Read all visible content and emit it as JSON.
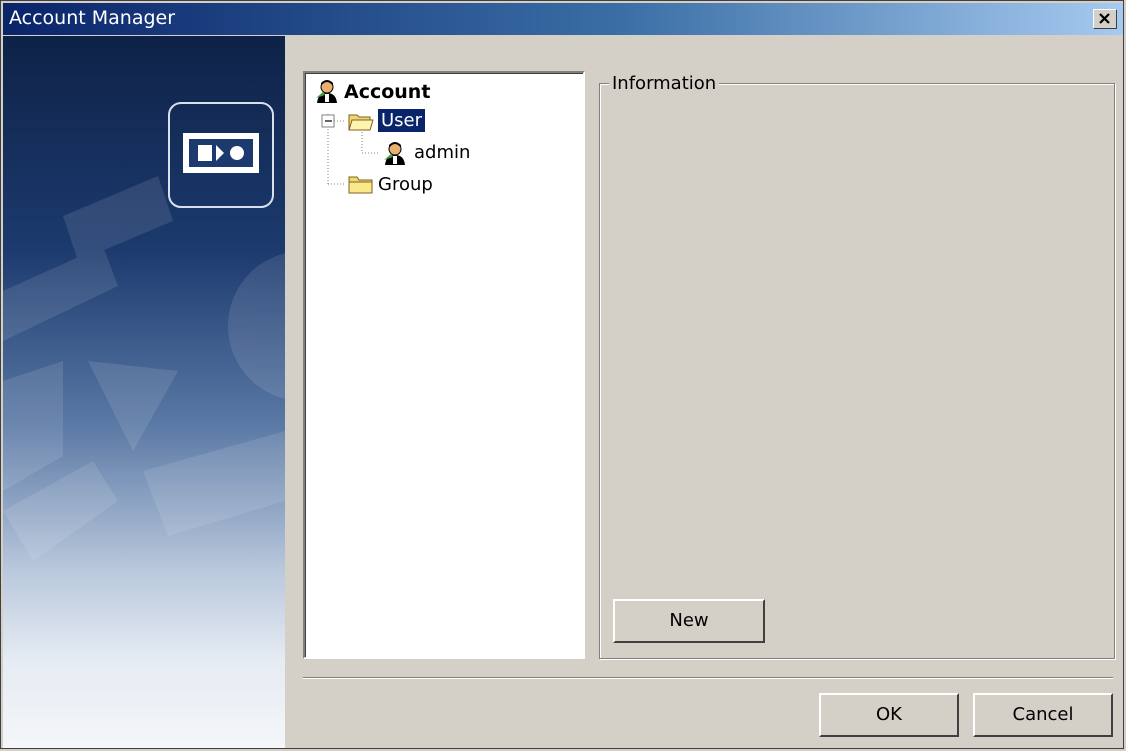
{
  "window": {
    "title": "Account Manager"
  },
  "tree": {
    "root": {
      "label": "Account",
      "icon": "user-icon"
    },
    "user_folder": {
      "label": "User",
      "icon": "open-folder-icon",
      "selected": true,
      "expanded": true
    },
    "user_admin": {
      "label": "admin",
      "icon": "user-icon"
    },
    "group_folder": {
      "label": "Group",
      "icon": "folder-icon"
    }
  },
  "info_panel": {
    "legend": "Information",
    "new_label": "New"
  },
  "footer": {
    "ok_label": "OK",
    "cancel_label": "Cancel"
  },
  "colors": {
    "selection": "#0a246a",
    "title_start": "#0a246a",
    "title_end": "#a6caf0",
    "face": "#d4d0c8"
  }
}
